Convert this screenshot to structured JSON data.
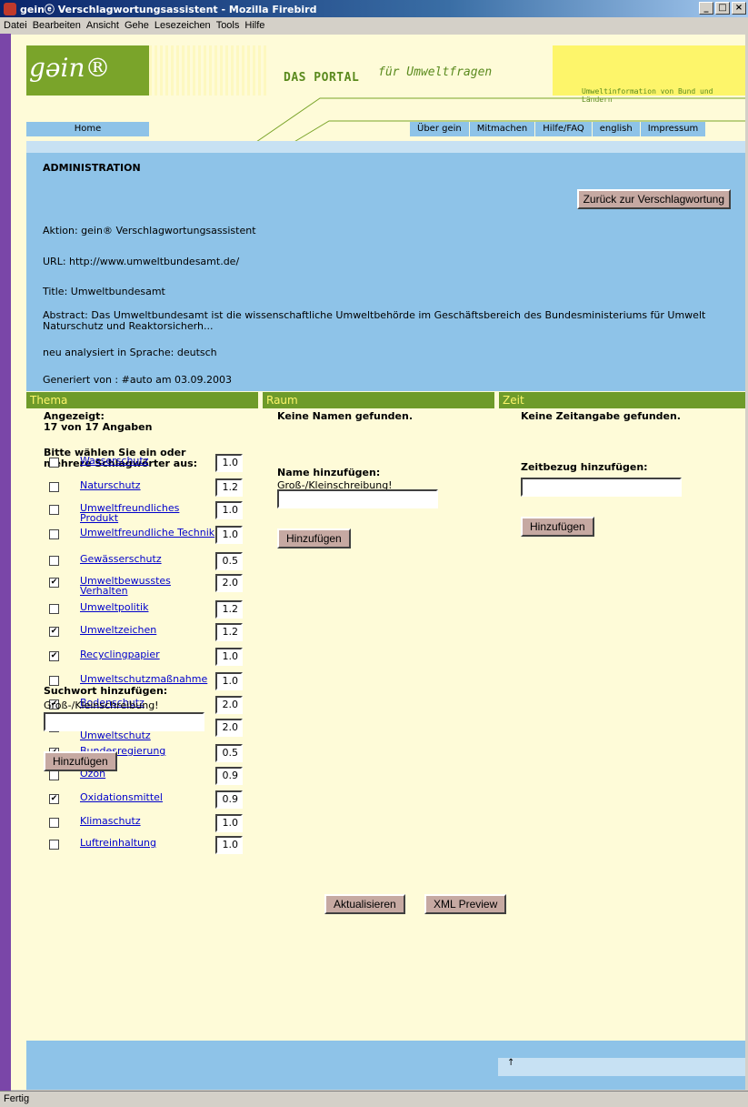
{
  "window": {
    "title": "geinⓔ Verschlagwortungsassistent - Mozilla Firebird",
    "min": "_",
    "max": "□",
    "close": "×"
  },
  "menubar": [
    "Datei",
    "Bearbeiten",
    "Ansicht",
    "Gehe",
    "Lesezeichen",
    "Tools",
    "Hilfe"
  ],
  "header": {
    "logo": "gəin®",
    "portal": "DAS PORTAL",
    "portal_sub": "für Umweltfragen",
    "tagline": "Umweltinformation von Bund und Ländern"
  },
  "nav": {
    "home": "Home",
    "links": [
      "Über gein",
      "Mitmachen",
      "Hilfe/FAQ",
      "english",
      "Impressum"
    ]
  },
  "admin": {
    "title": "ADMINISTRATION",
    "back_button": "Zurück zur Verschlagwortung",
    "aktion": "Aktion: gein® Verschlagwortungsassistent",
    "url": "URL: http://www.umweltbundesamt.de/",
    "title_line": "Title: Umweltbundesamt",
    "abstract": "Abstract: Das Umweltbundesamt ist die wissenschaftliche Umweltbehörde im Geschäftsbereich des Bundesministeriums für Umwelt Naturschutz und Reaktorsicherh...",
    "language": "neu analysiert in Sprache: deutsch",
    "generated": "Generiert von : #auto am 03.09.2003"
  },
  "thema": {
    "header": "Thema",
    "shown_label": "Angezeigt:",
    "shown_value": "17 von 17 Angaben",
    "instruction": "Bitte wählen Sie ein oder mehrere Schlagwörter aus:",
    "keywords": [
      {
        "label": "Wasserschutz",
        "value": "1.0",
        "checked": false
      },
      {
        "label": "Naturschutz",
        "value": "1.2",
        "checked": false
      },
      {
        "label": "Umweltfreundliches Produkt",
        "value": "1.0",
        "checked": false
      },
      {
        "label": "Umweltfreundliche Technik",
        "value": "1.0",
        "checked": false
      },
      {
        "label": "Gewässerschutz",
        "value": "0.5",
        "checked": false
      },
      {
        "label": "Umweltbewusstes Verhalten",
        "value": "2.0",
        "checked": true
      },
      {
        "label": "Umweltpolitik",
        "value": "1.2",
        "checked": false
      },
      {
        "label": "Umweltzeichen",
        "value": "1.2",
        "checked": true
      },
      {
        "label": "Recyclingpapier",
        "value": "1.0",
        "checked": true
      },
      {
        "label": "Umweltschutzmaßnahme",
        "value": "1.0",
        "checked": false
      },
      {
        "label": "Bodenschutz",
        "value": "2.0",
        "checked": true
      },
      {
        "label": "Betrieblicher Umweltschutz",
        "value": "2.0",
        "checked": true
      },
      {
        "label": "Bundesregierung",
        "value": "0.5",
        "checked": true
      },
      {
        "label": "Ozon",
        "value": "0.9",
        "checked": false
      },
      {
        "label": "Oxidationsmittel",
        "value": "0.9",
        "checked": true
      },
      {
        "label": "Klimaschutz",
        "value": "1.0",
        "checked": false
      },
      {
        "label": "Luftreinhaltung",
        "value": "1.0",
        "checked": false
      }
    ],
    "add_label": "Suchwort hinzufügen:",
    "case_hint": "Groß-/Kleinschreibung!",
    "add_value": "",
    "add_button": "Hinzufügen"
  },
  "raum": {
    "header": "Raum",
    "none": "Keine Namen gefunden.",
    "add_label": "Name hinzufügen:",
    "case_hint": "Groß-/Kleinschreibung!",
    "add_value": "",
    "add_button": "Hinzufügen"
  },
  "zeit": {
    "header": "Zeit",
    "none": "Keine Zeitangabe gefunden.",
    "add_label": "Zeitbezug hinzufügen:",
    "add_value": "",
    "add_button": "Hinzufügen"
  },
  "actions": {
    "update": "Aktualisieren",
    "xml_preview": "XML Preview"
  },
  "footer": {
    "arrow": "↑"
  },
  "status": "Fertig",
  "colors": {
    "green": "#6e9b2a",
    "blue": "#8ec3e8",
    "cream": "#fefbd8",
    "button": "#c6a9a2"
  }
}
